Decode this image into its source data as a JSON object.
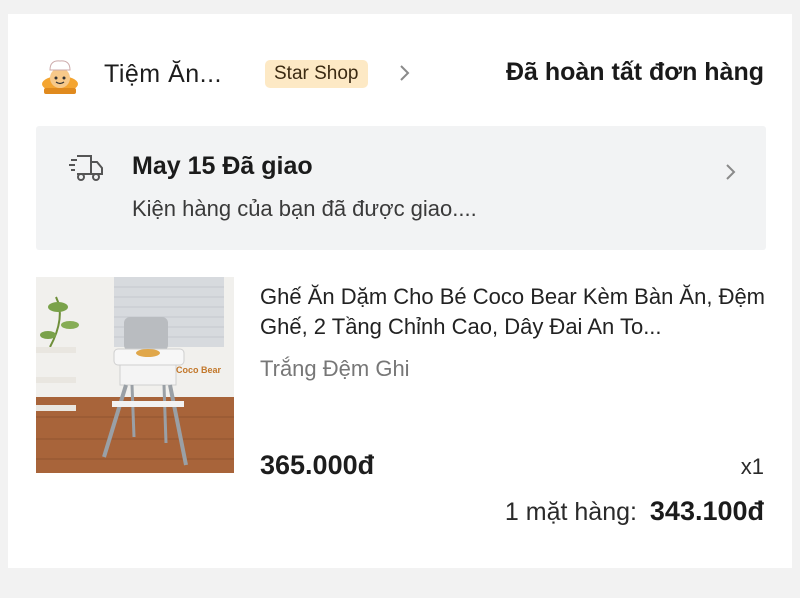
{
  "shop": {
    "name": "Tiệm Ăn...",
    "badge": "Star Shop",
    "logo_icon": "chef-logo-icon",
    "chevron_icon": "chevron-right-icon"
  },
  "order": {
    "status": "Đã hoàn tất đơn hàng"
  },
  "delivery": {
    "icon": "delivery-truck-icon",
    "title": "May 15 Đã giao",
    "subtitle": "Kiện hàng của bạn đã được giao....",
    "chevron_icon": "chevron-right-icon"
  },
  "product": {
    "name": "Ghế Ăn Dặm Cho Bé Coco Bear Kèm Bàn Ăn, Đệm Ghế, 2 Tầng Chỉnh Cao, Dây Đai An To...",
    "variant": "Trắng Đệm Ghi",
    "price": "365.000đ",
    "quantity": "x1",
    "image_brand_text": "Coco Bear"
  },
  "summary": {
    "label": "1 mặt hàng:",
    "total": "343.100đ"
  },
  "colors": {
    "badge_bg": "#fde9c5",
    "delivery_bg": "#f2f3f4",
    "page_bg": "#f2f2f2"
  }
}
